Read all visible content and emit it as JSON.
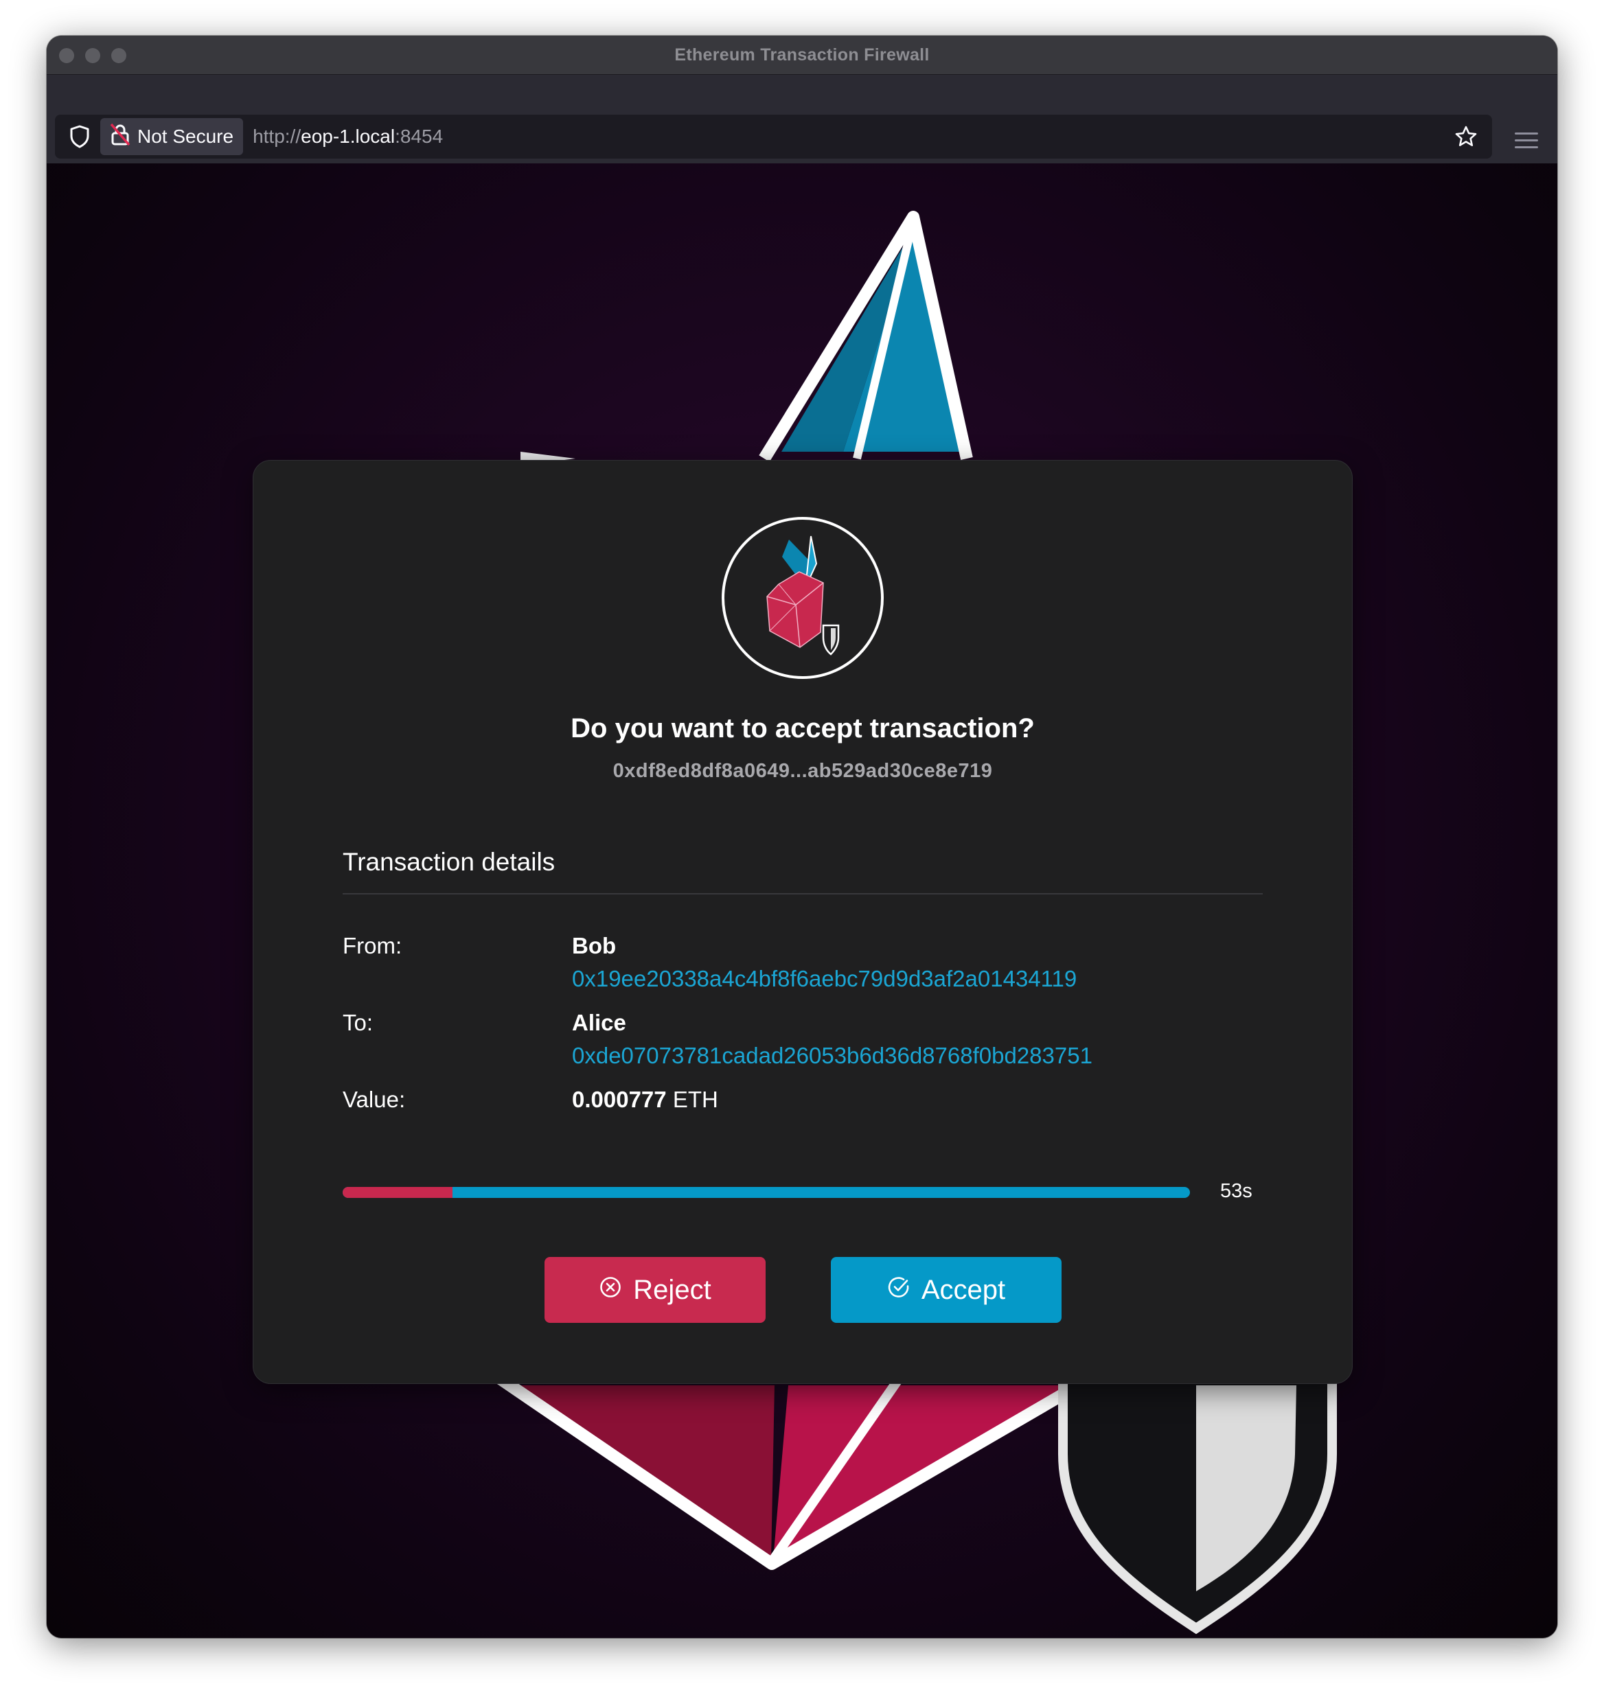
{
  "window": {
    "title": "Ethereum Transaction Firewall"
  },
  "toolbar": {
    "security_label": "Not Secure",
    "url_scheme": "http://",
    "url_host": "eop-1.local",
    "url_port": ":8454"
  },
  "dialog": {
    "question": "Do you want to accept transaction?",
    "tx_hash": "0xdf8ed8df8a0649...ab529ad30ce8e719",
    "section_title": "Transaction details",
    "from_label": "From:",
    "from_name": "Bob",
    "from_address": "0x19ee20338a4c4bf8f6aebc79d9d3af2a01434119",
    "to_label": "To:",
    "to_name": "Alice",
    "to_address": "0xde07073781cadad26053b6d36d8768f0bd283751",
    "value_label": "Value:",
    "value_amount": "0.000777",
    "value_unit": "ETH",
    "timer_text": "53s",
    "elapsed_fraction": 0.13,
    "reject_label": "Reject",
    "accept_label": "Accept"
  },
  "colors": {
    "reject": "#c82a4f",
    "accept": "#0599c8",
    "link": "#1ba6d4"
  }
}
